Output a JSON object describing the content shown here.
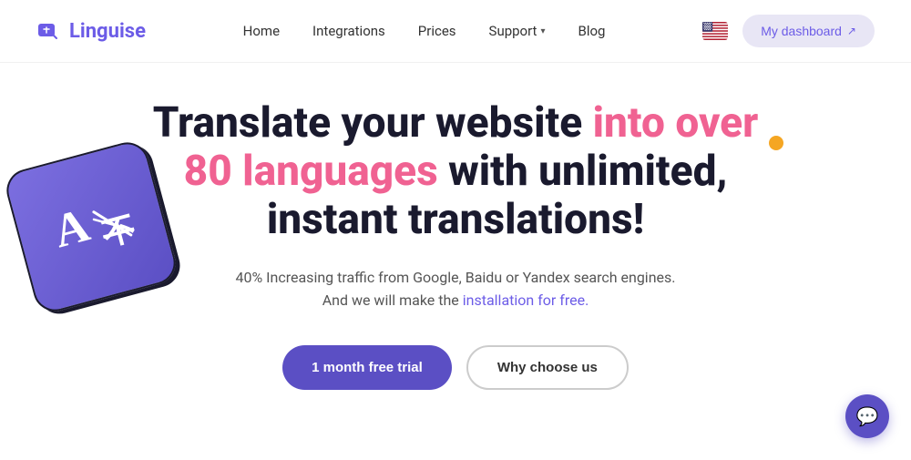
{
  "navbar": {
    "logo_text": "Linguise",
    "links": [
      {
        "label": "Home",
        "id": "home"
      },
      {
        "label": "Integrations",
        "id": "integrations"
      },
      {
        "label": "Prices",
        "id": "prices"
      },
      {
        "label": "Support",
        "id": "support",
        "has_dropdown": true
      },
      {
        "label": "Blog",
        "id": "blog"
      }
    ],
    "dashboard_button": "My dashboard"
  },
  "hero": {
    "title_part1": "Translate your website ",
    "title_highlight": "into over 80 languages",
    "title_part2": " with unlimited, instant translations!",
    "subtitle_line1": "40% Increasing traffic from Google, Baidu or Yandex search engines.",
    "subtitle_line2": "And we will make the ",
    "subtitle_link": "installation for free.",
    "button_primary": "1 month free trial",
    "button_secondary": "Why choose us"
  },
  "decorative": {
    "orange_dot": true,
    "chat_icon": "💬"
  }
}
